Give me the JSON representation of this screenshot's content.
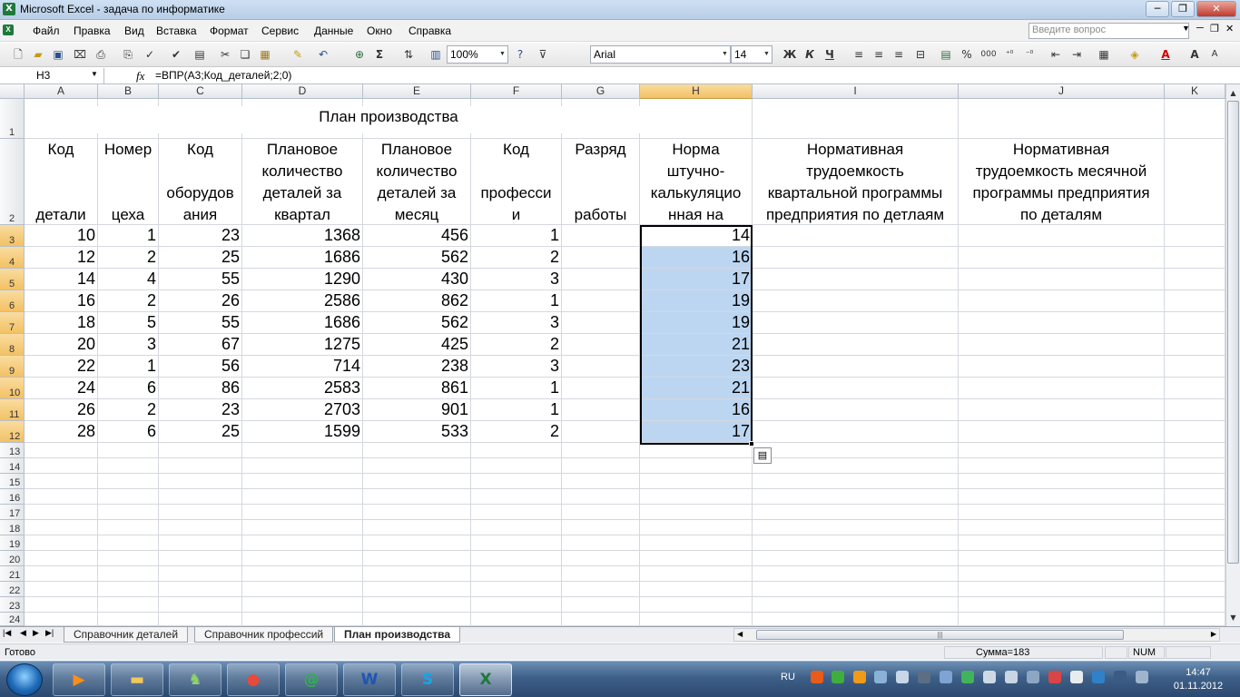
{
  "window": {
    "title": "Microsoft Excel - задача по информатике",
    "app_icon": "X"
  },
  "menu": [
    "Файл",
    "Правка",
    "Вид",
    "Вставка",
    "Формат",
    "Сервис",
    "Данные",
    "Окно",
    "Справка"
  ],
  "help_placeholder": "Введите вопрос",
  "toolbar": {
    "zoom": "100%",
    "font": "Arial",
    "size": "14",
    "bold": "Ж",
    "italic": "К",
    "underline": "Ч",
    "percent": "%",
    "thousands": "000",
    "sigma": "Σ"
  },
  "formula_bar": {
    "cell_ref": "H3",
    "fx": "fx",
    "formula": "=ВПР(A3;Код_деталей;2;0)"
  },
  "columns": [
    "A",
    "B",
    "C",
    "D",
    "E",
    "F",
    "G",
    "H",
    "I",
    "J",
    "K"
  ],
  "rows": [
    "1",
    "2",
    "3",
    "4",
    "5",
    "6",
    "7",
    "8",
    "9",
    "10",
    "11",
    "12",
    "13",
    "14",
    "15",
    "16",
    "17",
    "18",
    "19",
    "20",
    "21",
    "22",
    "23",
    "24"
  ],
  "sheet": {
    "title": "План производства",
    "headers": [
      [
        "Код",
        "",
        "",
        "детали"
      ],
      [
        "Номер",
        "",
        "",
        "цеха"
      ],
      [
        "Код",
        "",
        "оборудов",
        "ания"
      ],
      [
        "Плановое",
        "количество",
        "деталей за",
        "квартал"
      ],
      [
        "Плановое",
        "количество",
        "деталей за",
        "месяц"
      ],
      [
        "Код",
        "",
        "професси",
        "и"
      ],
      [
        "Разряд",
        "",
        "",
        "работы"
      ],
      [
        "Норма",
        "штучно-",
        "калькуляцио",
        "нная на"
      ],
      [
        "Нормативная",
        "трудоемкость",
        "квартальной программы",
        "предприятия по детлаям"
      ],
      [
        "Нормативная",
        "трудоемкость месячной",
        "программы предприятия",
        "по деталям"
      ]
    ],
    "data": [
      [
        "10",
        "1",
        "23",
        "1368",
        "456",
        "1",
        "",
        "14"
      ],
      [
        "12",
        "2",
        "25",
        "1686",
        "562",
        "2",
        "",
        "16"
      ],
      [
        "14",
        "4",
        "55",
        "1290",
        "430",
        "3",
        "",
        "17"
      ],
      [
        "16",
        "2",
        "26",
        "2586",
        "862",
        "1",
        "",
        "19"
      ],
      [
        "18",
        "5",
        "55",
        "1686",
        "562",
        "3",
        "",
        "19"
      ],
      [
        "20",
        "3",
        "67",
        "1275",
        "425",
        "2",
        "",
        "21"
      ],
      [
        "22",
        "1",
        "56",
        "714",
        "238",
        "3",
        "",
        "23"
      ],
      [
        "24",
        "6",
        "86",
        "2583",
        "861",
        "1",
        "",
        "21"
      ],
      [
        "26",
        "2",
        "23",
        "2703",
        "901",
        "1",
        "",
        "16"
      ],
      [
        "28",
        "6",
        "25",
        "1599",
        "533",
        "2",
        "",
        "17"
      ]
    ]
  },
  "tabs": [
    "Справочник деталей",
    "Справочник профессий",
    "План производства"
  ],
  "active_tab": 2,
  "status": {
    "ready": "Готово",
    "sum": "Сумма=183",
    "num": "NUM"
  },
  "taskbar": {
    "lang": "RU",
    "time": "14:47",
    "date": "01.11.2012"
  },
  "selection_color": "#bcd6f2",
  "accent": "#1d7a3a"
}
